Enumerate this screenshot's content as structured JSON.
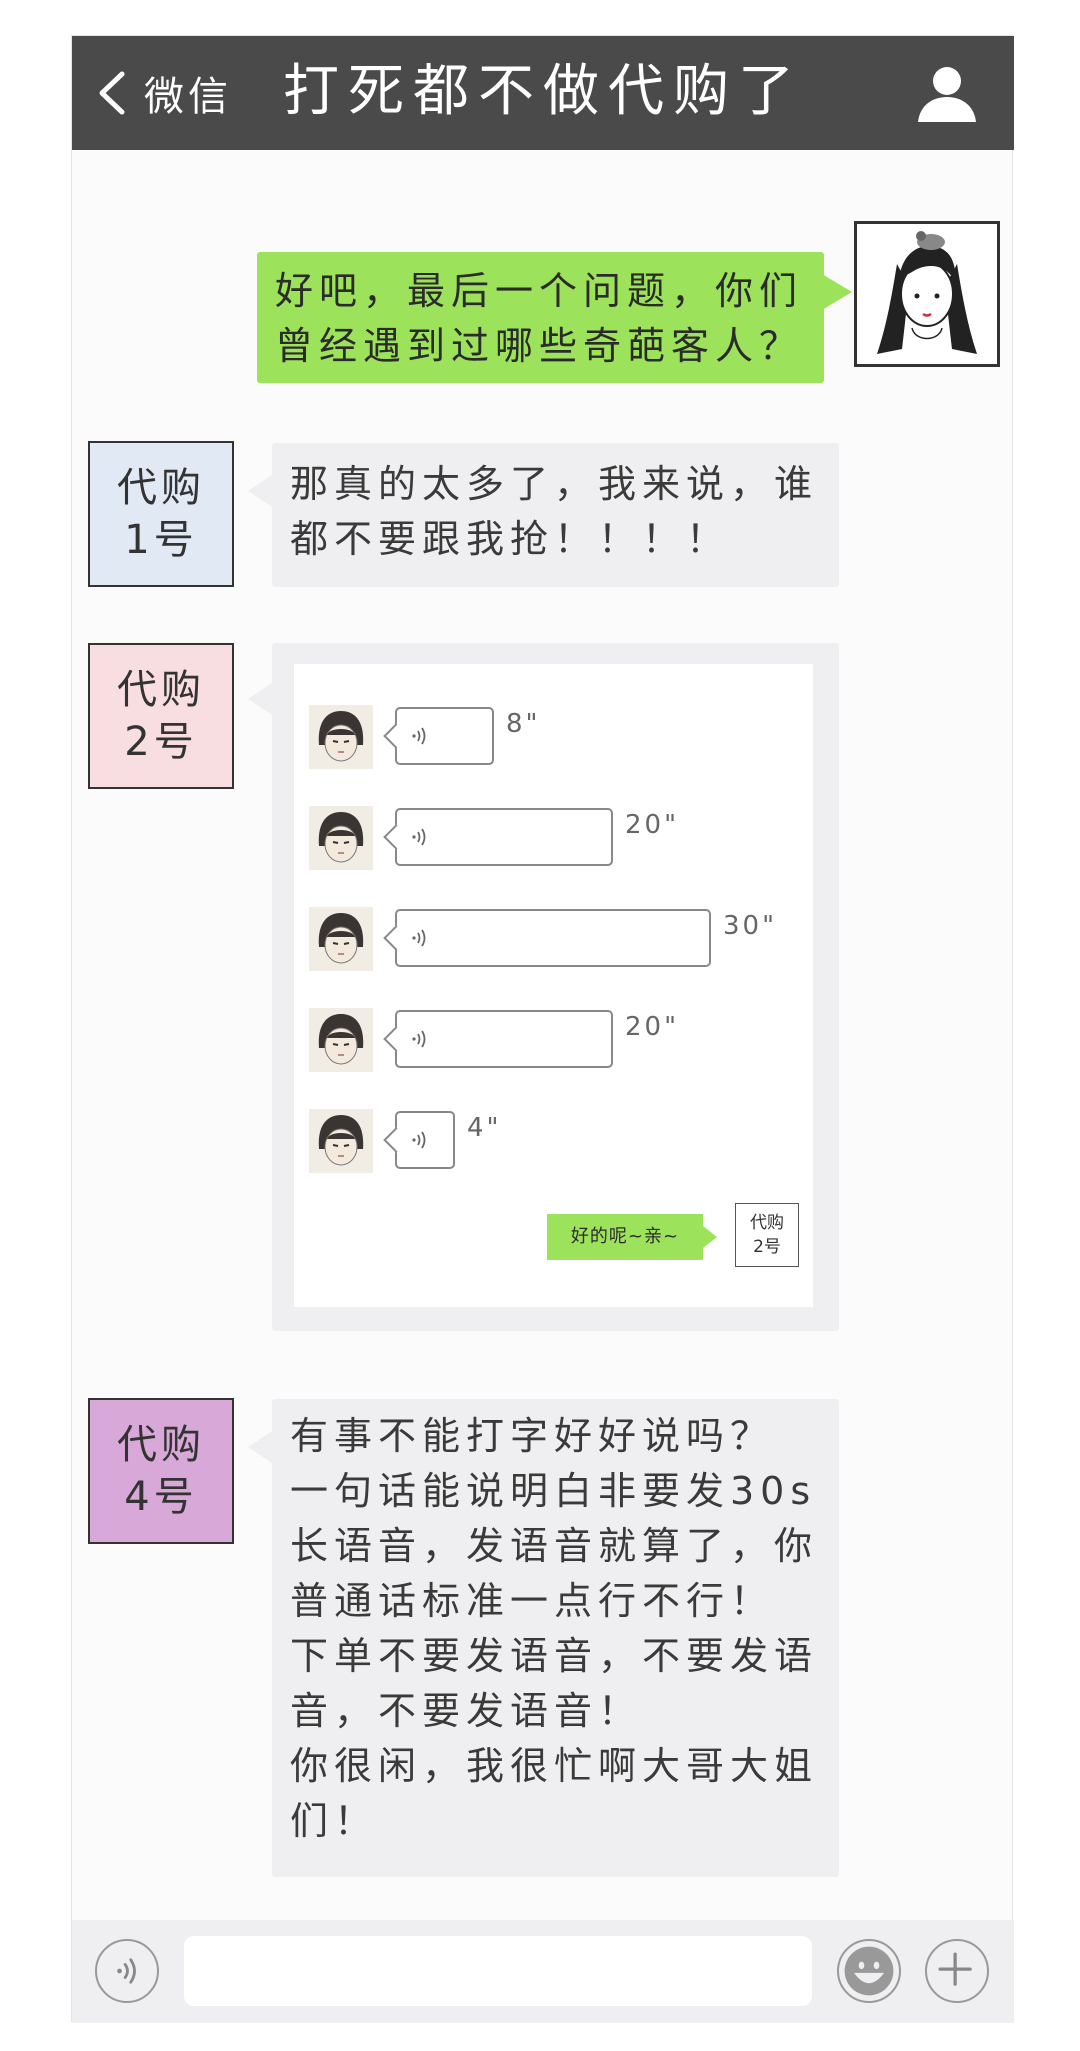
{
  "header": {
    "back_label": "微信",
    "title": "打死都不做代购了",
    "icons": {
      "back": "chevron-left-icon",
      "profile": "user-icon"
    }
  },
  "messages": {
    "question": {
      "line1": "好吧，最后一个问题，你们",
      "line2": "曾经遇到过哪些奇葩客人？"
    },
    "agent1": {
      "avatar_line1": "代购",
      "avatar_line2": "1号",
      "line1": "那真的太多了，我来说，谁",
      "line2": "都不要跟我抢！！！！"
    },
    "agent2": {
      "avatar_line1": "代购",
      "avatar_line2": "2号",
      "voice_messages": [
        {
          "duration": "8\"",
          "seconds": 8
        },
        {
          "duration": "20\"",
          "seconds": 20
        },
        {
          "duration": "30\"",
          "seconds": 30
        },
        {
          "duration": "20\"",
          "seconds": 20
        },
        {
          "duration": "4\"",
          "seconds": 4
        }
      ],
      "reply_text": "好的呢~亲~",
      "mini_avatar_line1": "代购",
      "mini_avatar_line2": "2号"
    },
    "agent4": {
      "avatar_line1": "代购",
      "avatar_line2": "4号",
      "lines": [
        "有事不能打字好好说吗？",
        "一句话能说明白非要发30s",
        "长语音，发语音就算了，你",
        "普通话标准一点行不行！",
        "下单不要发语音，不要发语",
        "音，不要发语音！",
        "你很闲，我很忙啊大哥大姐",
        "们！"
      ]
    }
  },
  "input_bar": {
    "icons": [
      "voice-icon",
      "emoji-icon",
      "plus-icon"
    ]
  },
  "colors": {
    "header_bg": "#4a4a4a",
    "sent_bubble": "#9ce35b",
    "received_bubble": "#efeff1",
    "agent1_bg": "#e1e9f4",
    "agent2_bg": "#f8dde1",
    "agent4_bg": "#d8a9d8"
  }
}
